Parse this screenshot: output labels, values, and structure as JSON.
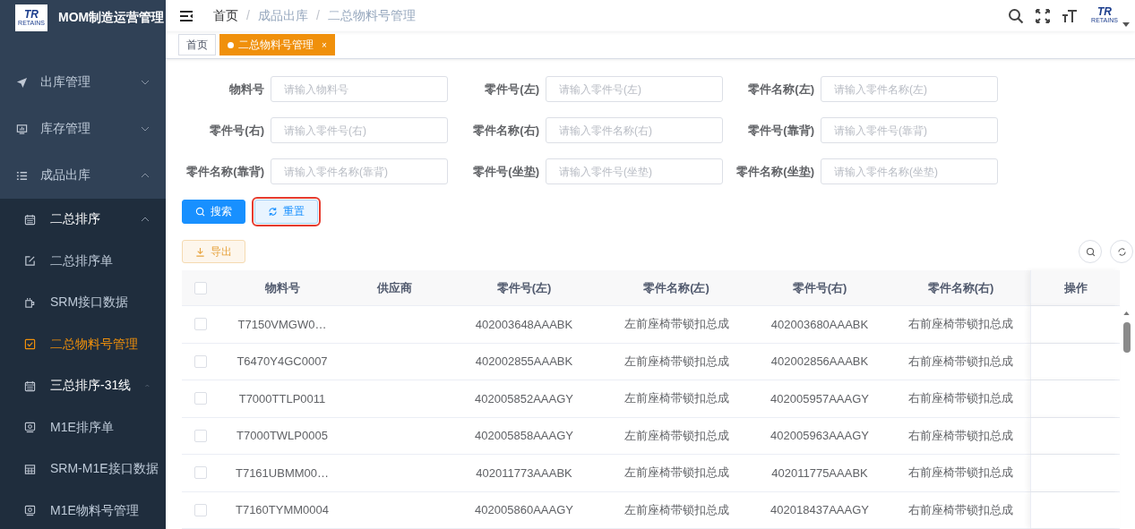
{
  "app": {
    "logo_text": "TR",
    "logo_sub": "RETAINS",
    "title": "MOM制造运营管理"
  },
  "sidebar": {
    "items": [
      {
        "label": "出库管理",
        "expanded": false,
        "selected": false
      },
      {
        "label": "库存管理",
        "expanded": false,
        "selected": false
      },
      {
        "label": "成品出库",
        "expanded": true,
        "selected": false,
        "children": [
          {
            "label": "二总排序",
            "expanded": true,
            "selected": false,
            "children": [
              {
                "label": "二总排序单",
                "selected": false
              },
              {
                "label": "SRM接口数据",
                "selected": false
              },
              {
                "label": "二总物料号管理",
                "selected": true
              }
            ]
          },
          {
            "label": "三总排序-31线",
            "expanded": true,
            "selected": false,
            "children": [
              {
                "label": "M1E排序单",
                "selected": false
              },
              {
                "label": "SRM-M1E接口数据",
                "selected": false
              },
              {
                "label": "M1E物料号管理",
                "selected": false
              }
            ]
          }
        ]
      }
    ]
  },
  "breadcrumb": [
    "首页",
    "成品出库",
    "二总物料号管理"
  ],
  "breadcrumb_separator": "/",
  "header_user": {
    "logo_text": "TR",
    "logo_sub": "RETAINS"
  },
  "tabs": [
    {
      "label": "首页",
      "selected": false,
      "closable": false
    },
    {
      "label": "二总物料号管理",
      "selected": true,
      "closable": true,
      "close": "×"
    }
  ],
  "filters": [
    {
      "label": "物料号",
      "placeholder": "请输入物料号"
    },
    {
      "label": "零件号(左)",
      "placeholder": "请输入零件号(左)"
    },
    {
      "label": "零件名称(左)",
      "placeholder": "请输入零件名称(左)"
    },
    {
      "label": "零件号(右)",
      "placeholder": "请输入零件号(右)"
    },
    {
      "label": "零件名称(右)",
      "placeholder": "请输入零件名称(右)"
    },
    {
      "label": "零件号(靠背)",
      "placeholder": "请输入零件号(靠背)"
    },
    {
      "label": "零件名称(靠背)",
      "placeholder": "请输入零件名称(靠背)"
    },
    {
      "label": "零件号(坐垫)",
      "placeholder": "请输入零件号(坐垫)"
    },
    {
      "label": "零件名称(坐垫)",
      "placeholder": "请输入零件名称(坐垫)"
    }
  ],
  "buttons": [
    {
      "label": "搜索",
      "kind": "primary",
      "highlighted": false
    },
    {
      "label": "重置",
      "kind": "reset",
      "highlighted": true
    }
  ],
  "export_button": "导出",
  "table": {
    "all_checked": false,
    "columns": [
      "物料号",
      "供应商",
      "零件号(左)",
      "零件名称(左)",
      "零件号(右)",
      "零件名称(右)",
      "操作"
    ],
    "rows": [
      {
        "checked": false,
        "cells": [
          "T7150VMGW0…",
          "",
          "402003648AAABK",
          "左前座椅带锁扣总成",
          "402003680AAABK",
          "右前座椅带锁扣总成",
          ""
        ]
      },
      {
        "checked": false,
        "cells": [
          "T6470Y4GC0007",
          "",
          "402002855AAABK",
          "左前座椅带锁扣总成",
          "402002856AAABK",
          "右前座椅带锁扣总成",
          ""
        ]
      },
      {
        "checked": false,
        "cells": [
          "T7000TTLP0011",
          "",
          "402005852AAAGY",
          "左前座椅带锁扣总成",
          "402005957AAAGY",
          "右前座椅带锁扣总成",
          ""
        ]
      },
      {
        "checked": false,
        "cells": [
          "T7000TWLP0005",
          "",
          "402005858AAAGY",
          "左前座椅带锁扣总成",
          "402005963AAAGY",
          "右前座椅带锁扣总成",
          ""
        ]
      },
      {
        "checked": false,
        "cells": [
          "T7161UBMM00…",
          "",
          "402011773AAABK",
          "左前座椅带锁扣总成",
          "402011775AAABK",
          "右前座椅带锁扣总成",
          ""
        ]
      },
      {
        "checked": false,
        "cells": [
          "T7160TYMM0004",
          "",
          "402005860AAAGY",
          "左前座椅带锁扣总成",
          "402018437AAAGY",
          "右前座椅带锁扣总成",
          ""
        ]
      }
    ]
  }
}
